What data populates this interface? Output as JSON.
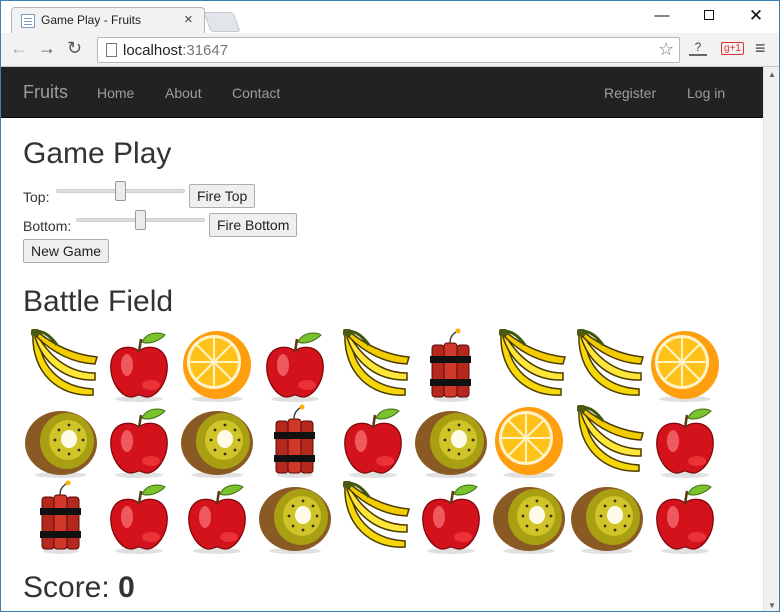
{
  "browser": {
    "tab_title": "Game Play - Fruits",
    "tab_close": "×",
    "url_host": "localhost",
    "url_port": ":31647",
    "ext_label": "g+1",
    "window_min": "—",
    "window_close": "✕"
  },
  "navbar": {
    "brand": "Fruits",
    "links": [
      "Home",
      "About",
      "Contact"
    ],
    "right_links": [
      "Register",
      "Log in"
    ]
  },
  "game": {
    "heading": "Game Play",
    "top_label": "Top:",
    "top_slider_fraction": 0.5,
    "fire_top": "Fire Top",
    "bottom_label": "Bottom:",
    "bottom_slider_fraction": 0.5,
    "fire_bottom": "Fire Bottom",
    "new_game": "New Game"
  },
  "battle": {
    "heading": "Battle Field",
    "rows": [
      [
        "banana",
        "apple",
        "orange",
        "apple",
        "banana",
        "dynamite",
        "banana",
        "banana",
        "orange"
      ],
      [
        "kiwi",
        "apple",
        "kiwi",
        "dynamite",
        "apple",
        "kiwi",
        "orange",
        "banana",
        "apple"
      ],
      [
        "dynamite",
        "apple",
        "apple",
        "kiwi",
        "banana",
        "apple",
        "kiwi",
        "kiwi",
        "apple"
      ]
    ]
  },
  "score": {
    "label": "Score:",
    "value": "0"
  },
  "colors": {
    "navbar_bg": "#222222",
    "nav_text": "#9d9d9d",
    "apple": "#d4121c",
    "banana": "#f6d80a",
    "orange": "#ff9f0f",
    "kiwi": "#a8a012",
    "dynamite": "#b5281e"
  }
}
